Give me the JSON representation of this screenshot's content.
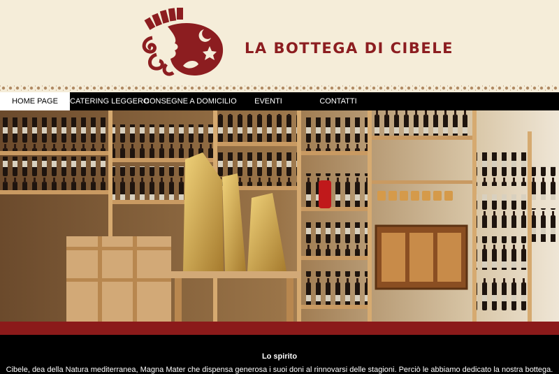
{
  "brand": {
    "name": "LA BOTTEGA DI CIBELE",
    "logo": "cibele-goddess-logo",
    "color": "#8c1d20",
    "background": "#f5edd9"
  },
  "nav": {
    "items": [
      {
        "label": "HOME PAGE",
        "active": true
      },
      {
        "label": "CATERING LEGGERO",
        "active": false
      },
      {
        "label": "CONSEGNE A DOMICILIO",
        "active": false
      },
      {
        "label": "EVENTI",
        "active": false
      },
      {
        "label": "CONTATTI",
        "active": false
      }
    ]
  },
  "hero": {
    "subject": "shop-interior-wine-shelves"
  },
  "section": {
    "title": "Lo spirito",
    "text": "Cibele, dea della Natura mediterranea, Magna Mater che dispensa generosa i suoi doni al rinnovarsi delle stagioni. Perciò le abbiamo dedicato la nostra bottega."
  },
  "colors": {
    "band": "#8b1a1a",
    "nav_bg": "#000000"
  }
}
